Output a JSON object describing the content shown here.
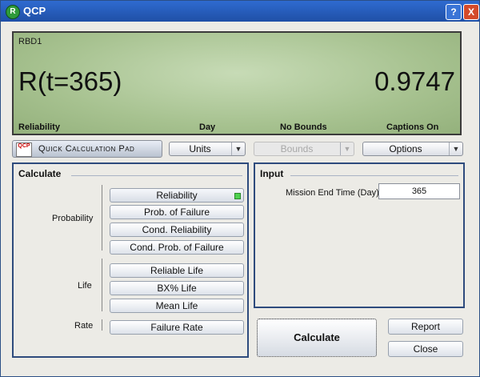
{
  "window": {
    "title": "QCP"
  },
  "titlebar": {
    "help_label": "?",
    "close_label": "X"
  },
  "display": {
    "name": "RBD1",
    "left_value": "R(t=365)",
    "right_value": "0.9747",
    "captions": [
      "Reliability",
      "Day",
      "No Bounds",
      "Captions On"
    ]
  },
  "toolbar": {
    "qcp_logo": "QCP",
    "qcp_label": "Quick Calculation Pad",
    "units_label": "Units",
    "bounds_label": "Bounds",
    "options_label": "Options"
  },
  "calculate": {
    "title": "Calculate",
    "groups": [
      {
        "label": "Probability",
        "buttons": [
          "Reliability",
          "Prob. of Failure",
          "Cond. Reliability",
          "Cond. Prob. of Failure"
        ]
      },
      {
        "label": "Life",
        "buttons": [
          "Reliable Life",
          "BX% Life",
          "Mean Life"
        ]
      },
      {
        "label": "Rate",
        "buttons": [
          "Failure Rate"
        ]
      }
    ]
  },
  "input": {
    "title": "Input",
    "mission_label": "Mission End Time (Day)",
    "mission_value": "365"
  },
  "actions": {
    "calculate_label": "Calculate",
    "report_label": "Report",
    "close_label": "Close"
  }
}
